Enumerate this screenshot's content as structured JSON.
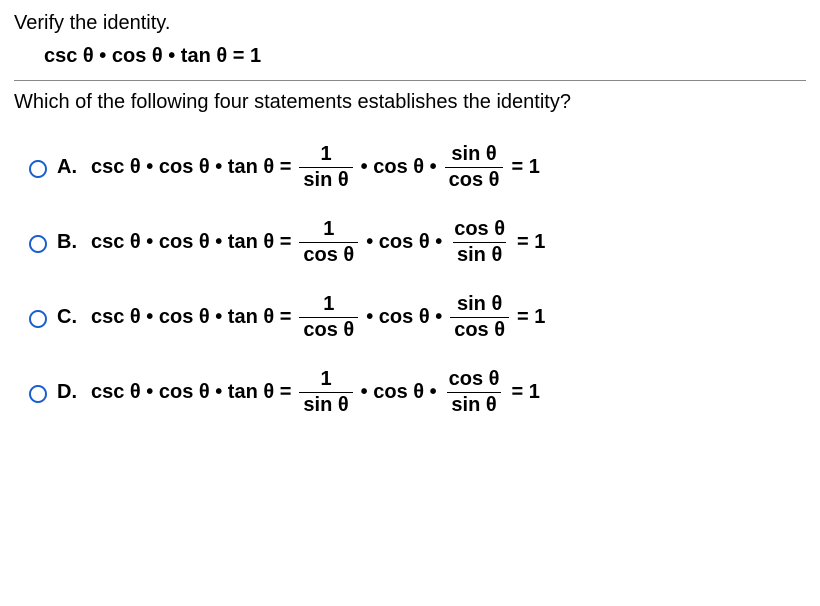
{
  "prompt": "Verify the identity.",
  "identity": "csc θ • cos θ • tan θ = 1",
  "question": "Which of the following four statements establishes the identity?",
  "lhs": "csc θ • cos θ • tan θ =",
  "middle": "• cos θ •",
  "tail": "= 1",
  "options": [
    {
      "label": "A.",
      "frac1_num": "1",
      "frac1_den": "sin θ",
      "frac2_num": "sin θ",
      "frac2_den": "cos θ"
    },
    {
      "label": "B.",
      "frac1_num": "1",
      "frac1_den": "cos θ",
      "frac2_num": "cos θ",
      "frac2_den": "sin θ"
    },
    {
      "label": "C.",
      "frac1_num": "1",
      "frac1_den": "cos θ",
      "frac2_num": "sin θ",
      "frac2_den": "cos θ"
    },
    {
      "label": "D.",
      "frac1_num": "1",
      "frac1_den": "sin θ",
      "frac2_num": "cos θ",
      "frac2_den": "sin θ"
    }
  ]
}
